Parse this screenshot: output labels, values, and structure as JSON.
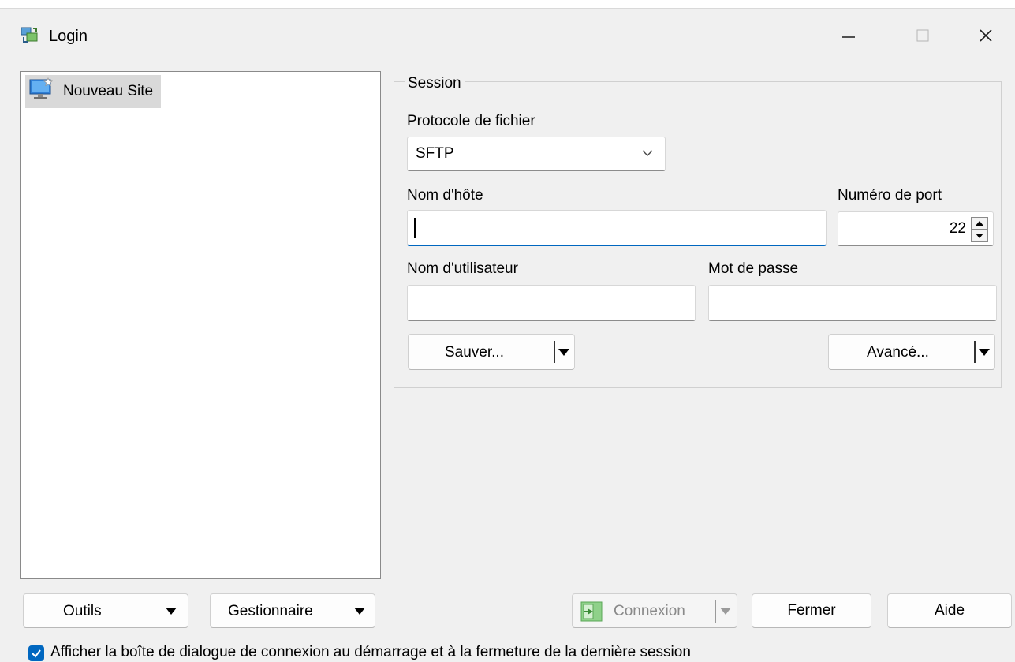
{
  "window": {
    "title": "Login",
    "controls": [
      "minimize-icon",
      "maximize-icon",
      "close-icon"
    ]
  },
  "site_tree": {
    "items": [
      {
        "label": "Nouveau Site",
        "icon": "new-site-computer-icon",
        "selected": true
      }
    ]
  },
  "session": {
    "group_label": "Session",
    "protocol_label": "Protocole de fichier",
    "protocol_value": "SFTP",
    "hostname_label": "Nom d'hôte",
    "hostname_value": "",
    "port_label": "Numéro de port",
    "port_value": "22",
    "username_label": "Nom d'utilisateur",
    "username_value": "",
    "password_label": "Mot de passe",
    "password_value": "",
    "save_label": "Sauver...",
    "advanced_label": "Avancé..."
  },
  "footer": {
    "tools_label": "Outils",
    "manager_label": "Gestionnaire",
    "connect_label": "Connexion",
    "close_label": "Fermer",
    "help_label": "Aide",
    "startup_checkbox_label": "Afficher la boîte de dialogue de connexion au démarrage et à la fermeture de la dernière session",
    "startup_checkbox_checked": true
  },
  "colors": {
    "accent": "#0067c0",
    "window_bg": "#f0f0f0",
    "selected_item_bg": "#d9d9d9"
  }
}
